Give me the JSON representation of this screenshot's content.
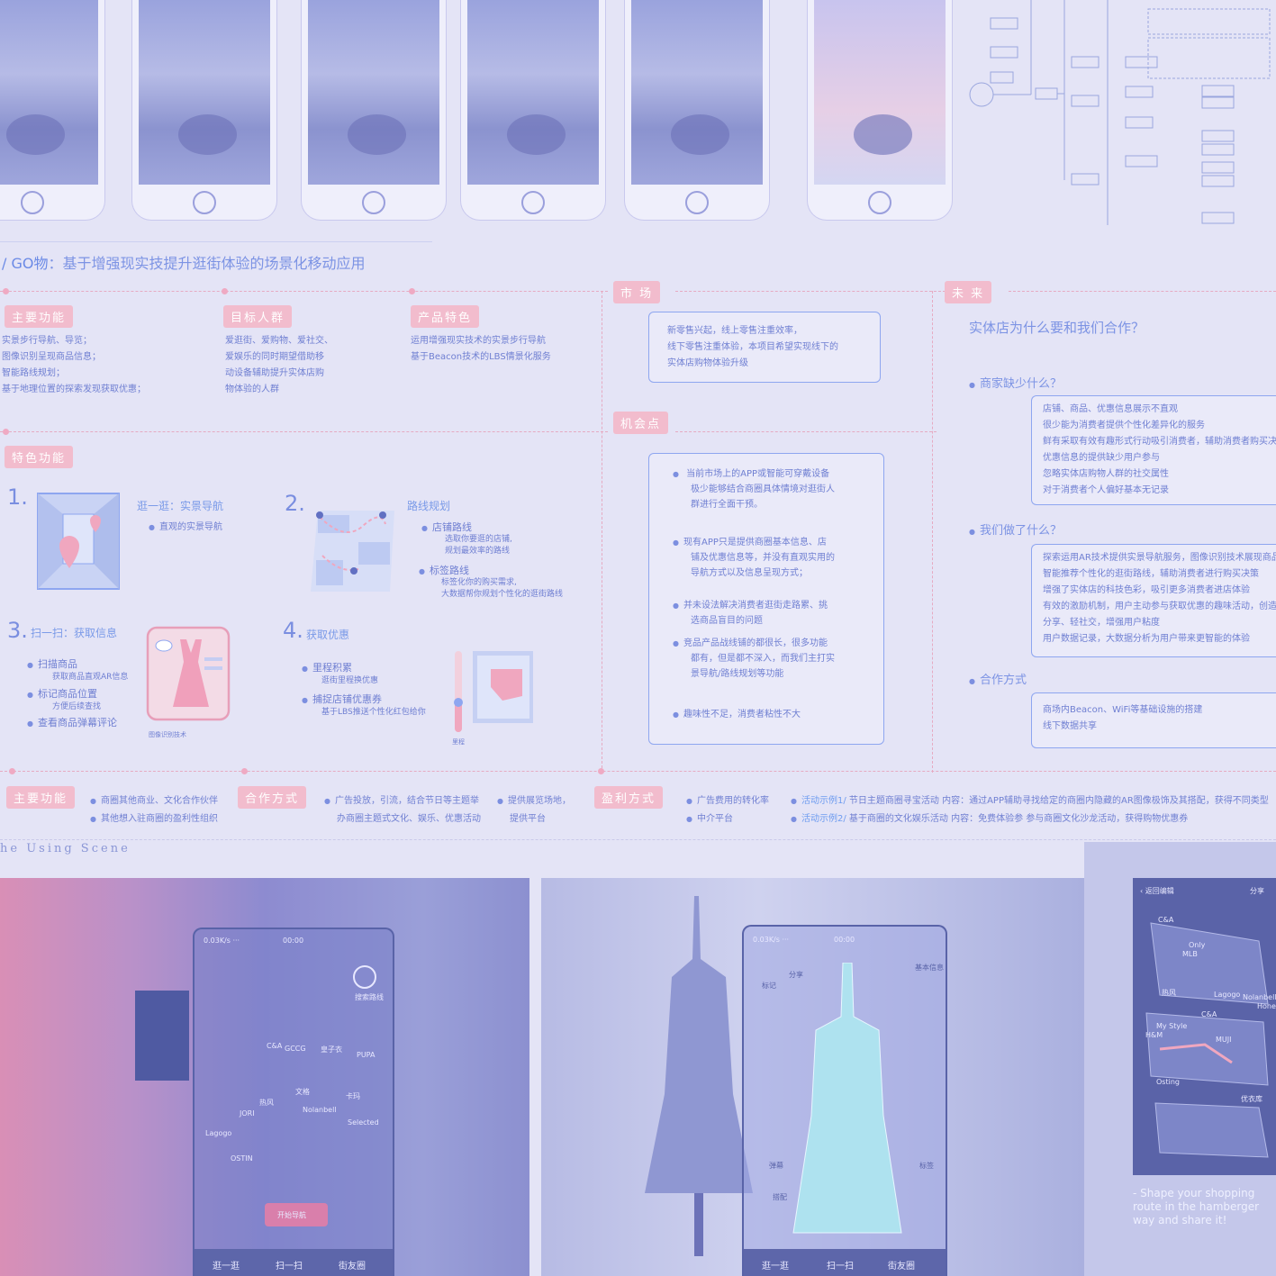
{
  "page_title": {
    "prefix": "/ GO物",
    "rest": "：基于增强现实技提升逛街体验的场景化移动应用"
  },
  "sections": {
    "main": {
      "tag": "主要功能",
      "lines": [
        "实景步行导航、导览；",
        "图像识别呈现商品信息；",
        "智能路线规划；",
        "基于地理位置的探索发现获取优惠；"
      ]
    },
    "target": {
      "tag": "目标人群",
      "lines": [
        "爱逛街、爱购物、爱社交、",
        "爱娱乐的同时期望借助移",
        "动设备辅助提升实体店购",
        "物体验的人群"
      ]
    },
    "product": {
      "tag": "产品特色",
      "lines": [
        "运用增强现实技术的实景步行导航",
        "基于Beacon技术的LBS情景化服务"
      ]
    },
    "feature": {
      "tag": "特色功能"
    },
    "market": {
      "tag": "市 场",
      "lines": [
        "新零售兴起，线上零售注重效率，",
        "线下零售注重体验，本项目希望实现线下的",
        "实体店购物体验升级"
      ]
    },
    "opportunity": {
      "tag": "机会点",
      "items": [
        [
          "当前市场上的APP或智能可穿戴设备",
          "极少能够结合商圈具体情境对逛街人",
          "群进行全面干预。"
        ],
        [
          "现有APP只是提供商圈基本信息、店",
          "铺及优惠信息等，并没有直观实用的",
          "导航方式以及信息呈现方式；"
        ],
        [
          "并未设法解决消费者逛街走路累、挑",
          "选商品盲目的问题"
        ],
        [
          "竞品产品战线铺的都很长，很多功能",
          "都有，但是都不深入，而我们主打实",
          "景导航/路线规划等功能"
        ],
        [
          "趣味性不足，消费者粘性不大"
        ]
      ]
    },
    "future": {
      "tag": "未 来",
      "question": "实体店为什么要和我们合作？",
      "q1": "商家缺少什么？",
      "q1_lines": [
        "店铺、商品、优惠信息展示不直观",
        "很少能为消费者提供个性化差异化的服务",
        "鲜有采取有效有趣形式行动吸引消费者，辅助消费者购买决",
        "优惠信息的提供缺少用户参与",
        "忽略实体店购物人群的社交属性",
        "对于消费者个人偏好基本无记录"
      ],
      "q2": "我们做了什么？",
      "q2_lines": [
        "探索运用AR技术提供实景导航服务，图像识别技术展现商品",
        "智能推荐个性化的逛街路线，辅助消费者进行购买决策",
        "增强了实体店的科技色彩，吸引更多消费者进店体验",
        "有效的激励机制，用户主动参与获取优惠的趣味活动，创造",
        "分享、轻社交，增强用户粘度",
        "用户数据记录，大数据分析为用户带来更智能的体验"
      ],
      "q3": "合作方式",
      "q3_lines": [
        "商场内Beacon、WiFi等基础设施的搭建",
        "线下数据共享"
      ]
    }
  },
  "features": [
    {
      "num": "1.",
      "title": "逛一逛：实景导航",
      "items": [
        [
          "直观的实景导航"
        ]
      ]
    },
    {
      "num": "2.",
      "title": "路线规划",
      "items": [
        [
          "店铺路线",
          "选取你要逛的店铺,",
          "规划最效率的路线"
        ],
        [
          "标签路线",
          "标签化你的购买需求,",
          "大数据帮你规划个性化的逛街路线"
        ]
      ]
    },
    {
      "num": "3.",
      "title": "扫一扫：获取信息",
      "items": [
        [
          "扫描商品",
          "获取商品直观AR信息"
        ],
        [
          "标记商品位置",
          "方便后续查找"
        ],
        [
          "查看商品弹幕评论"
        ]
      ],
      "caption": "图像识别技术"
    },
    {
      "num": "4.",
      "title": "获取优惠",
      "items": [
        [
          "里程积累",
          "逛街里程换优惠"
        ],
        [
          "捕捉店铺优惠券",
          "基于LBS推送个性化红包给你"
        ]
      ],
      "caption": "里程"
    }
  ],
  "bottom_row": {
    "main_tag": "主要功能",
    "main": [
      "商圈其他商业、文化合作伙伴",
      "其他想入驻商圈的盈利性组织"
    ],
    "coop_tag": "合作方式",
    "coop_a": [
      "广告投放，引流，结合节日等主题举",
      "办商圈主题式文化、娱乐、优惠活动"
    ],
    "coop_b": [
      "提供展览场地，",
      "提供平台"
    ],
    "profit_tag": "盈利方式",
    "profit": [
      "广告费用的转化率",
      "中介平台"
    ],
    "ex1_label": "活动示例1/",
    "ex1": " 节日主题商圈寻宝活动  内容：通过APP辅助寻找给定的商圈内隐藏的AR图像极饰及其搭配，获得不同类型",
    "ex2_label": "活动示例2/",
    "ex2": " 基于商圈的文化娱乐活动  内容：免费体验参  参与商圈文化沙龙活动，获得购物优惠券"
  },
  "scene_title": "he Using Scene",
  "scene": {
    "status": "0.03K/s ···",
    "time": "00:00",
    "nav_tabs": [
      "逛一逛",
      "扫一扫",
      "街友圈"
    ],
    "shops_left": [
      "C&A",
      "GCCG",
      "皇子衣",
      "PUPA",
      "文格",
      "卡玛",
      "JORI",
      "热风",
      "Nolanbell",
      "Lagogo",
      "Selected",
      "OSTIN"
    ],
    "search_label": "搜索路线",
    "start_nav": "开始导航",
    "dress_tags": [
      "标记",
      "分享",
      "弹幕",
      "搭配",
      "基本信息",
      "标签"
    ],
    "map_back": "返回编辑",
    "map_share": "分享",
    "map_shops": [
      "C&A",
      "Only",
      "MLB",
      "热风",
      "Lagogo",
      "Nolanbell",
      "Honey",
      "C&A",
      "My Style",
      "H&M",
      "MUJI",
      "Osting",
      "优衣库"
    ],
    "shape_text": [
      "- Shape your shopping",
      "route in the hamberger",
      "way and share it!"
    ]
  },
  "colors": {
    "accent": "#7c93e4",
    "pink": "#f2bccd",
    "bg": "#e4e4f6"
  }
}
